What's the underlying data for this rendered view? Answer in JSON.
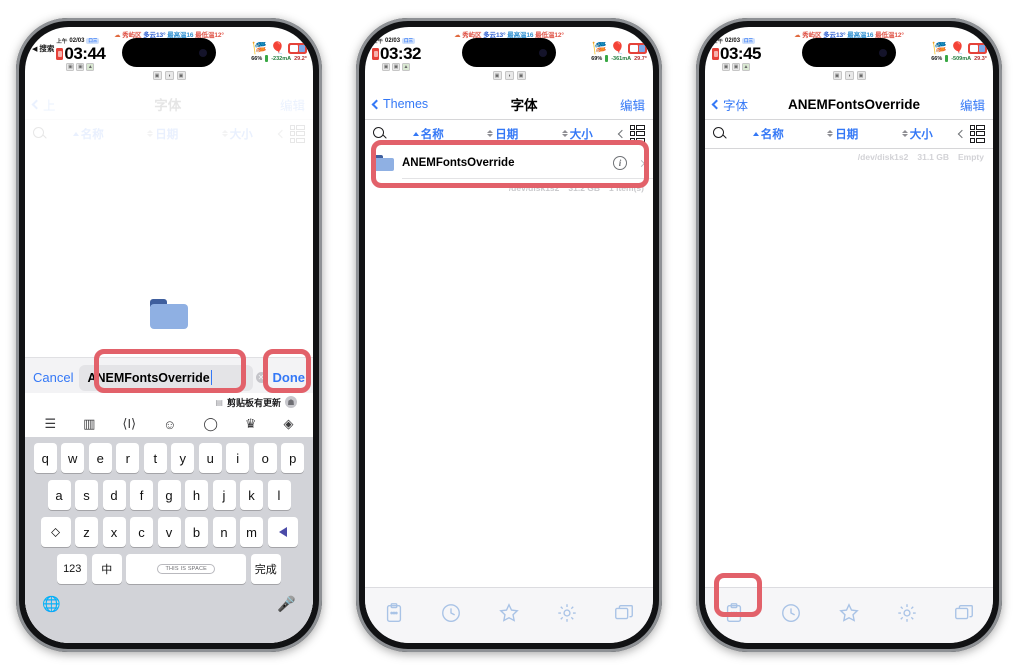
{
  "meta": {
    "device": "iPhone",
    "accent_blue": "#3478f6",
    "annotation_red": "#e2616a"
  },
  "statusbar": {
    "weather": {
      "cloud_icon": "cloud-icon",
      "location": "秀屿区",
      "condition": "多云13°",
      "high": "最高温16",
      "low": "最低温12°"
    },
    "back_arrow": "◀",
    "back_text": "搜索",
    "ampm": "上午",
    "date": "02/03",
    "date_badge": "口三",
    "phone1_time": "03:44",
    "phone2_time": "03:32",
    "phone3_time": "03:45",
    "battery_pct_p1": "66%",
    "battery_ma_p1": "-232mA",
    "battery_temp_p1": "29.2°",
    "battery_pct_p2": "69%",
    "battery_ma_p2": "-361mA",
    "battery_temp_p2": "29.7°",
    "battery_pct_p3": "66%",
    "battery_ma_p3": "-509mA",
    "battery_temp_p3": "29.3°",
    "mini_icons": [
      "screen-record-icon",
      "focus-icon",
      "vpn-icon"
    ],
    "below_icons": [
      "photo-icon",
      "sound-icon",
      "screenshot-icon"
    ]
  },
  "phone1": {
    "dimmed_nav": {
      "back": "上",
      "title": "字体",
      "edit": "编辑"
    },
    "dimmed_sort": {
      "search": "search-icon",
      "name": "名称",
      "date": "日期",
      "size": "大小"
    },
    "folder_icon": "folder-icon",
    "rename": {
      "cancel_label": "Cancel",
      "value": "ANEMFontsOverride",
      "clear_icon": "clear-icon",
      "done_label": "Done"
    },
    "keyboard": {
      "suggest_clip_icon": "clipboard-icon",
      "suggest_text": "剪贴板有更新",
      "avatar": "avatar-icon",
      "toolbar": [
        "menu-icon",
        "sticker-icon",
        "cursor-icon",
        "emoji-icon",
        "search-icon",
        "shirt-icon",
        "gift-icon",
        "more-icon"
      ],
      "row1": [
        "q",
        "w",
        "e",
        "r",
        "t",
        "y",
        "u",
        "i",
        "o",
        "p"
      ],
      "row2": [
        "a",
        "s",
        "d",
        "f",
        "g",
        "h",
        "j",
        "k",
        "l"
      ],
      "row3_shift": "⬦",
      "row3": [
        "z",
        "x",
        "c",
        "v",
        "b",
        "n",
        "m"
      ],
      "row3_delete": "delete-icon",
      "num_key": "123",
      "lang_key": "中",
      "space_key": "THIS IS SPACE",
      "done_key": "完成",
      "globe_icon": "globe-icon",
      "mic_icon": "microphone-icon"
    }
  },
  "phone2": {
    "nav": {
      "back_label": "Themes",
      "title": "字体",
      "edit": "编辑"
    },
    "sort": {
      "name": "名称",
      "date": "日期",
      "size": "大小"
    },
    "rows": [
      {
        "icon": "folder-icon",
        "name": "ANEMFontsOverride",
        "info": "i",
        "chevron": "›"
      }
    ],
    "footer": {
      "device": "/dev/disk1s2",
      "size": "31.2 GB",
      "count": "1 item(s)"
    },
    "tabbar": [
      "clipboard-icon",
      "clock-icon",
      "star-icon",
      "gear-icon",
      "windows-icon"
    ]
  },
  "phone3": {
    "nav": {
      "back_label": "字体",
      "title": "ANEMFontsOverride",
      "edit": "编辑"
    },
    "sort": {
      "name": "名称",
      "date": "日期",
      "size": "大小"
    },
    "rows": [],
    "footer": {
      "device": "/dev/disk1s2",
      "size": "31.1 GB",
      "count": "Empty"
    },
    "tabbar": [
      "clipboard-icon",
      "clock-icon",
      "star-icon",
      "gear-icon",
      "windows-icon"
    ]
  }
}
